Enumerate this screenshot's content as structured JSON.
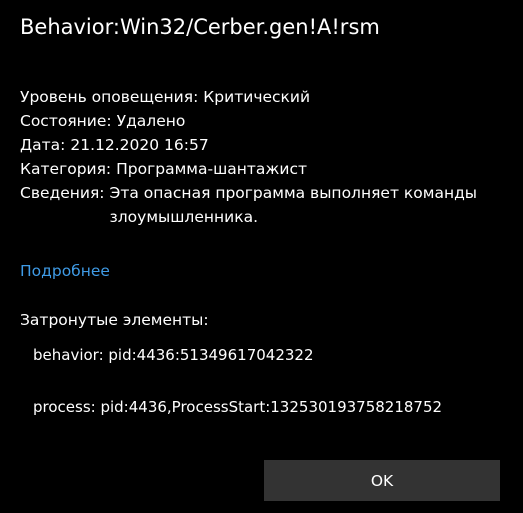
{
  "dialog": {
    "title": "Behavior:Win32/Cerber.gen!A!rsm",
    "details": [
      {
        "label": "Уровень оповещения:",
        "value": "Критический"
      },
      {
        "label": "Состояние:",
        "value": "Удалено"
      },
      {
        "label": "Дата:",
        "value": "21.12.2020 16:57"
      },
      {
        "label": "Категория:",
        "value": "Программа-шантажист"
      },
      {
        "label": "Сведения:",
        "value": "Эта опасная программа выполняет команды злоумышленника."
      }
    ],
    "more_link": "Подробнее",
    "affected_heading": "Затронутые элементы:",
    "affected_items": [
      "behavior: pid:4436:51349617042322",
      "process: pid:4436,ProcessStart:132530193758218752"
    ],
    "ok_label": "OK"
  },
  "colors": {
    "background": "#000000",
    "text": "#ffffff",
    "link": "#3f9be6",
    "button": "#333333"
  }
}
